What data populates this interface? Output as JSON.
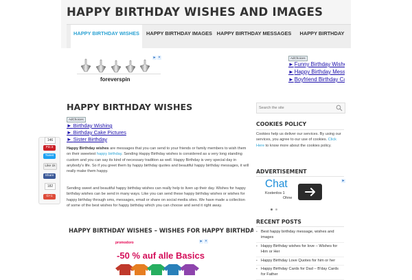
{
  "site": {
    "title": "HAPPY BIRTHDAY WISHES AND IMAGES"
  },
  "nav": {
    "items": [
      {
        "label": "HAPPY BIRTHDAY WISHES",
        "active": true
      },
      {
        "label": "HAPPY BIRTHDAY IMAGES",
        "active": false
      },
      {
        "label": "HAPPY BIRTHDAY MESSAGES",
        "active": false
      },
      {
        "label": "HAPPY BIRTHDAY",
        "active": false
      }
    ]
  },
  "top_ad": {
    "product_text": "foreverspin",
    "adchoices_label": "AdChoices",
    "links": [
      "Funny Birthday Wishes",
      "Happy Birthday Messages",
      "Boyfriend Birthday Card"
    ]
  },
  "main": {
    "title": "HAPPY BIRTHDAY WISHES",
    "adchoices_label": "AdChoices",
    "ad_links": [
      "Birthday Wishing",
      "Birthday Cake Pictures",
      "Sister Birthday"
    ],
    "para1": {
      "bold": "Happy Birthday wishes",
      "text1": " are messages that you can send to your friends or family members to wish them on their sweetest ",
      "link": "happy birthday",
      "text2": ". Sending Happy Birthday wishes is considered as a very long standing custom and you can say its kind of necessary tradition as well. Happy Birthday is very special day in anybody's life. So if you greet them by happy birthday quotes and beautiful happy birthday messages, it will really make them happy."
    },
    "para2": "Sending sweet and beautiful happy birthday wishes can really help to liven up their day. Wishes for happy birthday wishes can be send in many ways. Like you can send these happy birthday wishes or wishes for happy birthday through sms, messages, email or share on social media sites. We have made a collection of some of the best wishes for happy birthday which you can choose and send it right away.",
    "subheading": "HAPPY BIRTHDAY WISHES – WISHES FOR HAPPY BIRTHDAY",
    "promo": {
      "brand": "promodoro",
      "text": "-50 % auf alle Basics"
    }
  },
  "share": {
    "top_count": "146",
    "pin_label": "Pin it",
    "tweet_label": "Tweet",
    "like_label": "Like",
    "like_count": "1k",
    "fb_label": "Share",
    "fb_count": "182",
    "gplus_label": "G+1"
  },
  "sidebar": {
    "search_placeholder": "Search the site",
    "cookies": {
      "title": "COOKIES POLICY",
      "text1": "Cookies help us deliver our services. By using our services, you agree to our use of cookies. ",
      "link": "Click Here",
      "text2": " to know more about the cookies policy."
    },
    "advertisement": {
      "title": "ADVERTISEMENT",
      "chat_word": "Chat",
      "chat_sub1": "Kostenlos 1",
      "chat_sub2": "Ohne"
    },
    "recent": {
      "title": "RECENT POSTS",
      "posts": [
        "Best happy birthday message, wishes and images",
        "Happy Birthday wishes for love – Wishes for Him or Her",
        "Happy Birthday Love Quotes for him or her",
        "Happy Birthday Cards for Dad – B'day Cards for Father"
      ]
    }
  },
  "colors": {
    "accent": "#2ba2d3",
    "link": "#1a0dab",
    "twitter": "#1da1f2",
    "facebook": "#3b5998",
    "pinterest": "#cb2027",
    "gplus": "#dd4b39"
  }
}
